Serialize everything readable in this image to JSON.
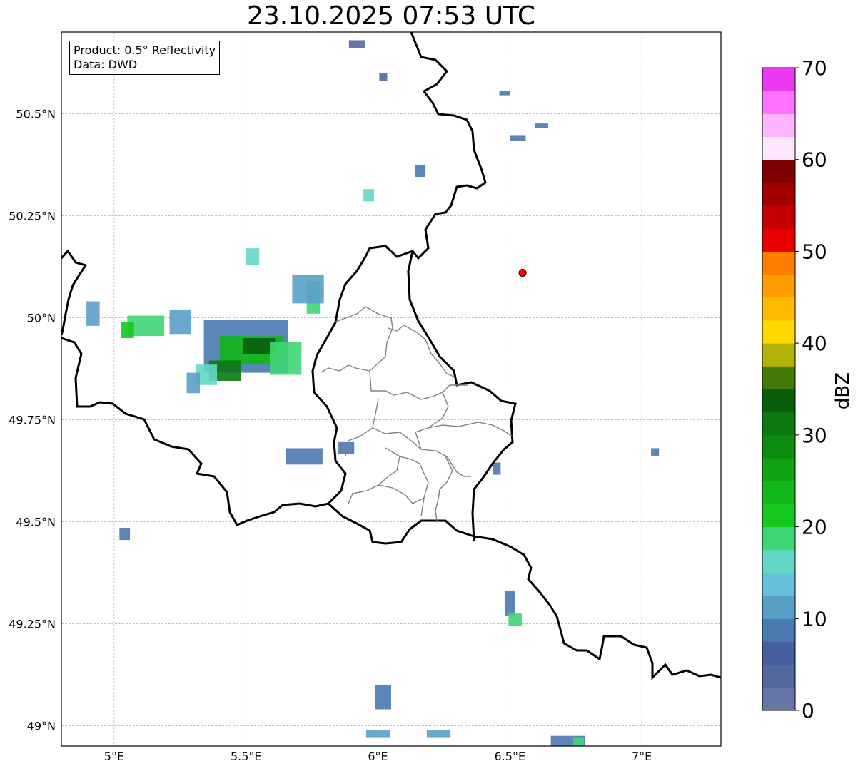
{
  "title": "23.10.2025 07:53 UTC",
  "info_box": {
    "line1": "Product: 0.5° Reflectivity",
    "line2": "Data: DWD"
  },
  "map": {
    "lon_range": [
      4.8,
      7.3
    ],
    "lat_range": [
      48.95,
      50.7
    ],
    "lon_ticks": [
      {
        "v": 5.0,
        "label": "5°E"
      },
      {
        "v": 5.5,
        "label": "5.5°E"
      },
      {
        "v": 6.0,
        "label": "6°E"
      },
      {
        "v": 6.5,
        "label": "6.5°E"
      },
      {
        "v": 7.0,
        "label": "7°E"
      }
    ],
    "lat_ticks": [
      {
        "v": 49.0,
        "label": "49°N"
      },
      {
        "v": 49.25,
        "label": "49.25°N"
      },
      {
        "v": 49.5,
        "label": "49.5°N"
      },
      {
        "v": 49.75,
        "label": "49.75°N"
      },
      {
        "v": 50.0,
        "label": "50°N"
      },
      {
        "v": 50.25,
        "label": "50.25°N"
      },
      {
        "v": 50.5,
        "label": "50.5°N"
      }
    ],
    "radar_site": {
      "lon": 6.548,
      "lat": 50.11,
      "color": "#ff0000"
    }
  },
  "colorbar": {
    "label": "dBZ",
    "tick_labels": [
      "0",
      "10",
      "20",
      "30",
      "40",
      "50",
      "60",
      "70"
    ],
    "colors": [
      "#6575a8",
      "#5468a0",
      "#445e9e",
      "#4a78b0",
      "#5a9ec8",
      "#66c0da",
      "#62d8c4",
      "#3ed674",
      "#14c81e",
      "#12b81a",
      "#10a414",
      "#0e8c12",
      "#0c7810",
      "#0a5e0c",
      "#447a0a",
      "#b0b206",
      "#ffd800",
      "#ffba00",
      "#ff9c00",
      "#ff7e00",
      "#e60000",
      "#c40000",
      "#a20000",
      "#7e0000",
      "#ffe6ff",
      "#ffb4ff",
      "#ff72ff",
      "#e838f0"
    ]
  },
  "echoes": [
    {
      "lon": 5.25,
      "lat": 49.99,
      "w": 0.08,
      "h": 0.06,
      "c": "#5a9ec8"
    },
    {
      "lon": 5.12,
      "lat": 49.98,
      "w": 0.14,
      "h": 0.05,
      "c": "#3ed674"
    },
    {
      "lon": 5.05,
      "lat": 49.97,
      "w": 0.05,
      "h": 0.04,
      "c": "#14c81e"
    },
    {
      "lon": 4.92,
      "lat": 50.01,
      "w": 0.05,
      "h": 0.06,
      "c": "#5a9ec8"
    },
    {
      "lon": 5.5,
      "lat": 49.93,
      "w": 0.32,
      "h": 0.13,
      "c": "#4a78b0"
    },
    {
      "lon": 5.52,
      "lat": 49.92,
      "w": 0.24,
      "h": 0.07,
      "c": "#12b81a"
    },
    {
      "lon": 5.55,
      "lat": 49.93,
      "w": 0.12,
      "h": 0.04,
      "c": "#0a5e0c"
    },
    {
      "lon": 5.42,
      "lat": 49.87,
      "w": 0.12,
      "h": 0.05,
      "c": "#0c7810"
    },
    {
      "lon": 5.65,
      "lat": 49.9,
      "w": 0.12,
      "h": 0.08,
      "c": "#3ed674"
    },
    {
      "lon": 5.35,
      "lat": 49.86,
      "w": 0.08,
      "h": 0.05,
      "c": "#62d8c4"
    },
    {
      "lon": 5.3,
      "lat": 49.84,
      "w": 0.05,
      "h": 0.05,
      "c": "#5a9ec8"
    },
    {
      "lon": 5.755,
      "lat": 50.05,
      "w": 0.05,
      "h": 0.08,
      "c": "#3ed674"
    },
    {
      "lon": 5.735,
      "lat": 50.07,
      "w": 0.12,
      "h": 0.07,
      "c": "#5a9ec8"
    },
    {
      "lon": 5.525,
      "lat": 50.15,
      "w": 0.05,
      "h": 0.04,
      "c": "#62d8c4"
    },
    {
      "lon": 5.72,
      "lat": 49.66,
      "w": 0.14,
      "h": 0.04,
      "c": "#4a78b0"
    },
    {
      "lon": 5.88,
      "lat": 49.68,
      "w": 0.06,
      "h": 0.03,
      "c": "#4a78b0"
    },
    {
      "lon": 5.965,
      "lat": 50.3,
      "w": 0.04,
      "h": 0.03,
      "c": "#62d8c4"
    },
    {
      "lon": 6.16,
      "lat": 50.36,
      "w": 0.04,
      "h": 0.03,
      "c": "#4a78b0"
    },
    {
      "lon": 6.02,
      "lat": 50.59,
      "w": 0.03,
      "h": 0.02,
      "c": "#5468a0"
    },
    {
      "lon": 5.92,
      "lat": 50.67,
      "w": 0.06,
      "h": 0.02,
      "c": "#5468a0"
    },
    {
      "lon": 6.53,
      "lat": 50.44,
      "w": 0.06,
      "h": 0.015,
      "c": "#4a78b0"
    },
    {
      "lon": 6.62,
      "lat": 50.47,
      "w": 0.05,
      "h": 0.012,
      "c": "#4a78b0"
    },
    {
      "lon": 6.48,
      "lat": 50.55,
      "w": 0.04,
      "h": 0.01,
      "c": "#4a78b0"
    },
    {
      "lon": 6.5,
      "lat": 49.3,
      "w": 0.04,
      "h": 0.06,
      "c": "#4a78b0"
    },
    {
      "lon": 6.52,
      "lat": 49.26,
      "w": 0.05,
      "h": 0.03,
      "c": "#3ed674"
    },
    {
      "lon": 6.45,
      "lat": 49.63,
      "w": 0.03,
      "h": 0.03,
      "c": "#4a78b0"
    },
    {
      "lon": 7.05,
      "lat": 49.67,
      "w": 0.03,
      "h": 0.02,
      "c": "#4a78b0"
    },
    {
      "lon": 5.04,
      "lat": 49.47,
      "w": 0.04,
      "h": 0.03,
      "c": "#4a78b0"
    },
    {
      "lon": 6.02,
      "lat": 49.07,
      "w": 0.06,
      "h": 0.06,
      "c": "#4a78b0"
    },
    {
      "lon": 6.0,
      "lat": 48.98,
      "w": 0.09,
      "h": 0.02,
      "c": "#5a9ec8"
    },
    {
      "lon": 6.23,
      "lat": 48.98,
      "w": 0.09,
      "h": 0.02,
      "c": "#5a9ec8"
    },
    {
      "lon": 6.72,
      "lat": 48.96,
      "w": 0.13,
      "h": 0.03,
      "c": "#4a78b0"
    },
    {
      "lon": 6.76,
      "lat": 48.96,
      "w": 0.04,
      "h": 0.02,
      "c": "#3ed674"
    }
  ]
}
